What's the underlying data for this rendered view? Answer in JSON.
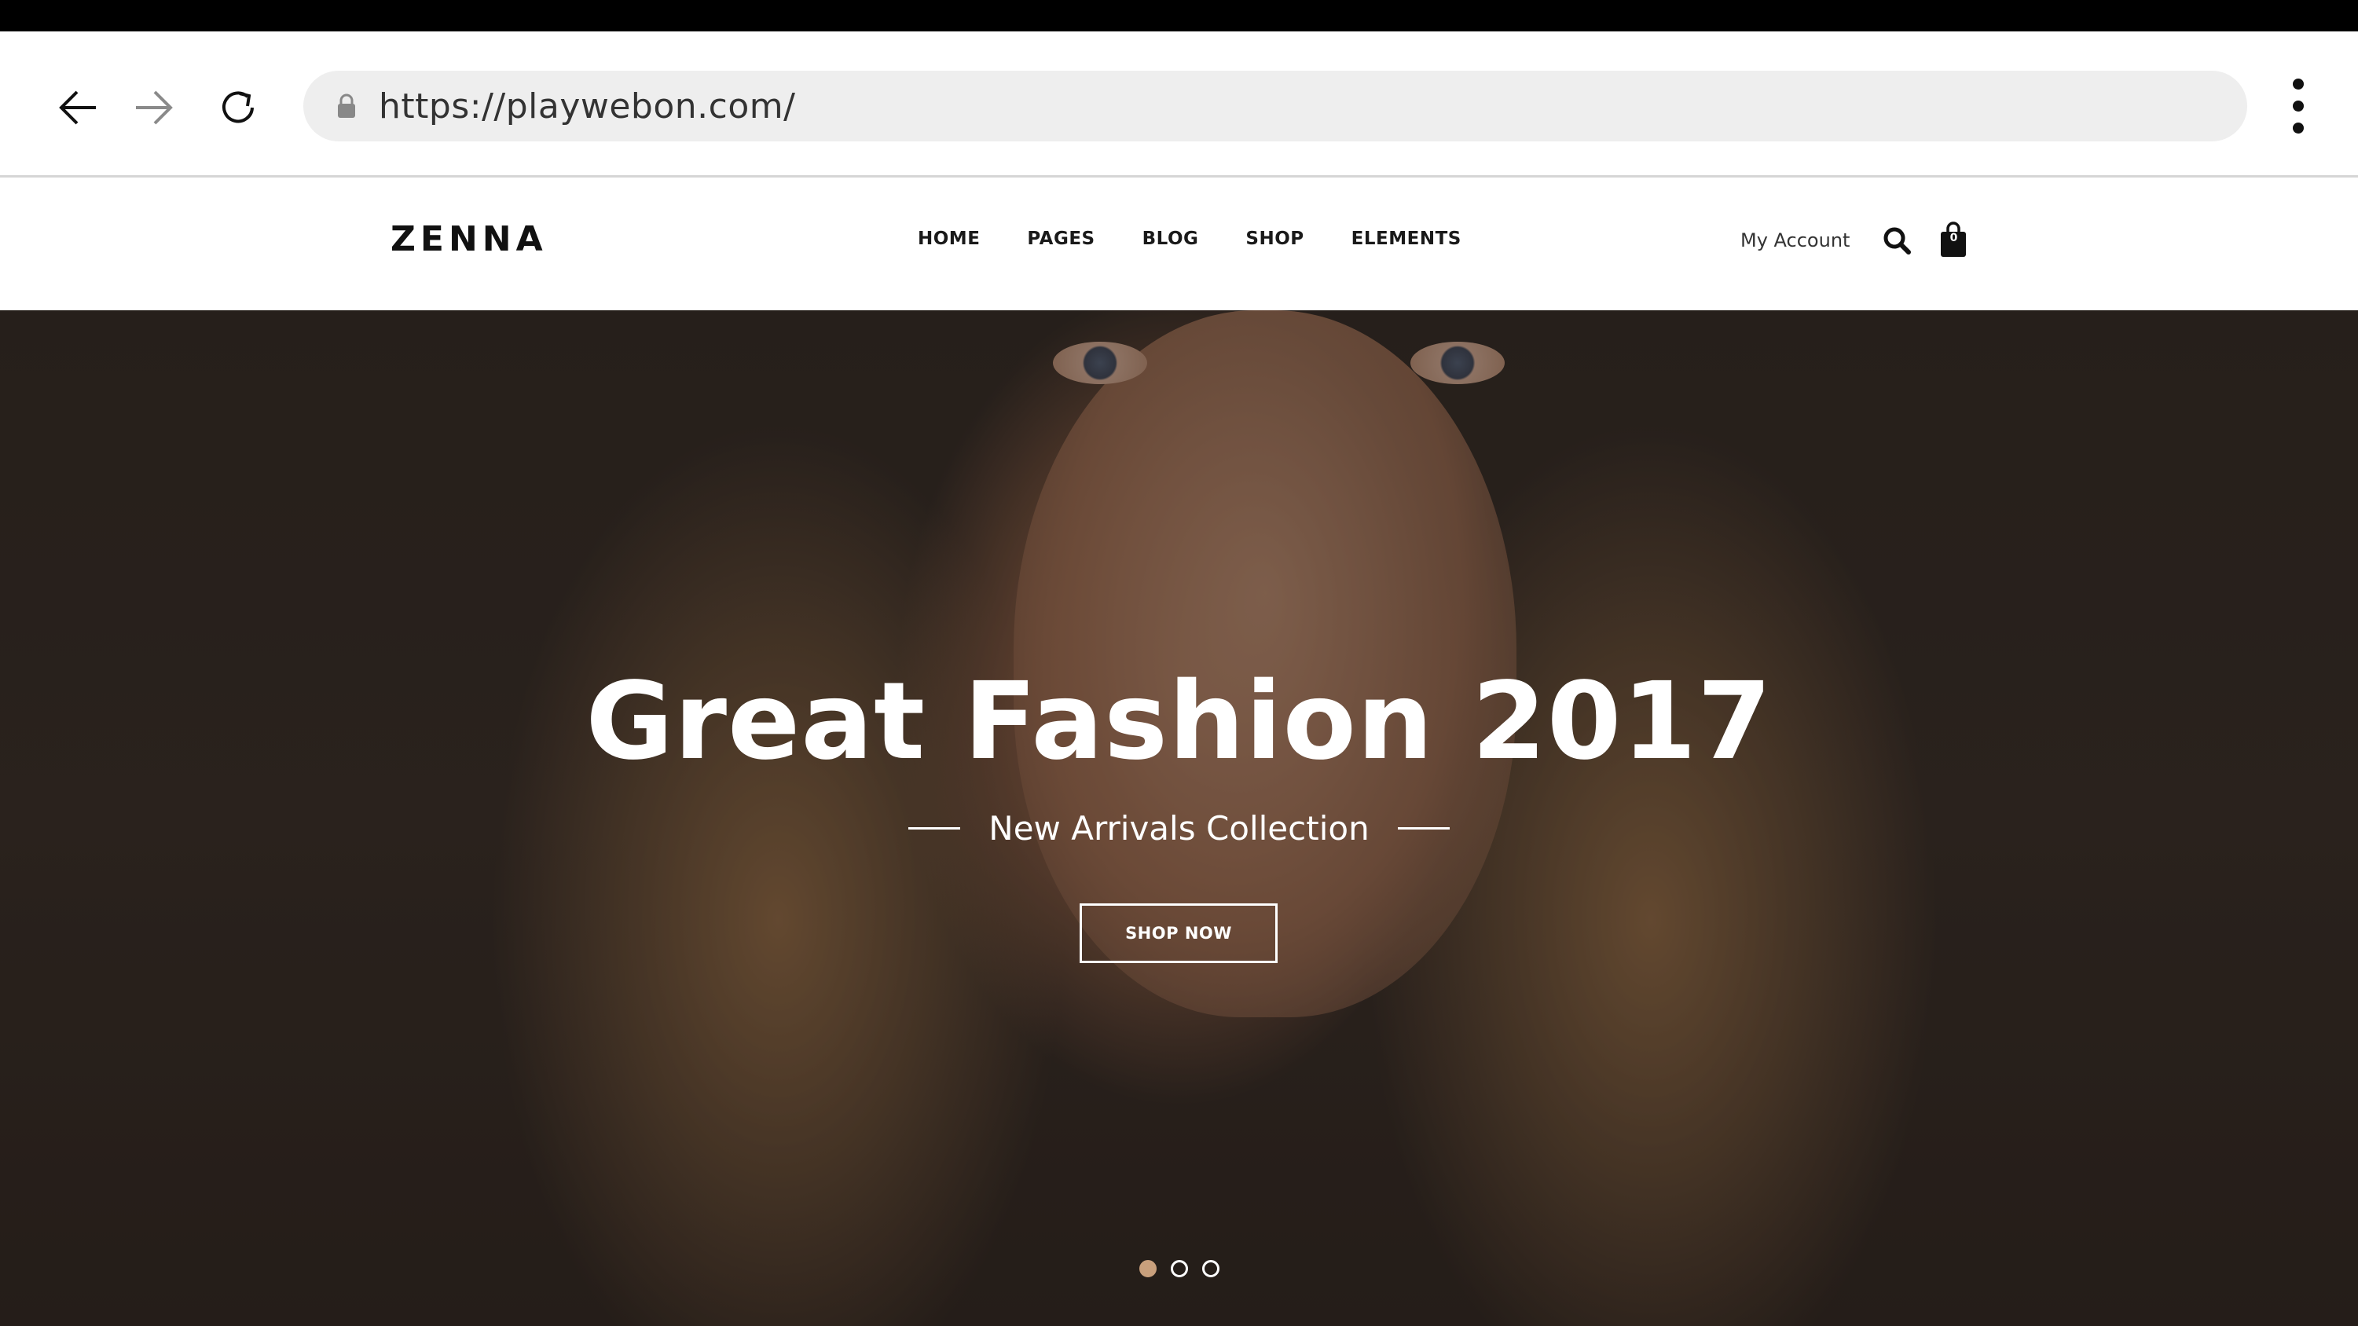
{
  "browser": {
    "url": "https://playwebon.com/"
  },
  "header": {
    "logo": "ZENNA",
    "nav": [
      {
        "label": "HOME"
      },
      {
        "label": "PAGES"
      },
      {
        "label": "BLOG"
      },
      {
        "label": "SHOP"
      },
      {
        "label": "ELEMENTS"
      }
    ],
    "account_label": "My Account",
    "cart_count": "0"
  },
  "hero": {
    "title": "Great Fashion 2017",
    "subtitle": "New Arrivals Collection",
    "cta_label": "SHOP NOW",
    "slides": 3,
    "active_slide": 1
  },
  "colors": {
    "accent": "#c9a07c",
    "text_dark": "#111111",
    "url_bar": "#eeeeee"
  },
  "icons": {
    "back": "arrow-left-icon",
    "forward": "arrow-right-icon",
    "reload": "reload-icon",
    "lock": "lock-icon",
    "menu": "more-vertical-icon",
    "search": "search-icon",
    "cart": "shopping-bag-icon"
  }
}
